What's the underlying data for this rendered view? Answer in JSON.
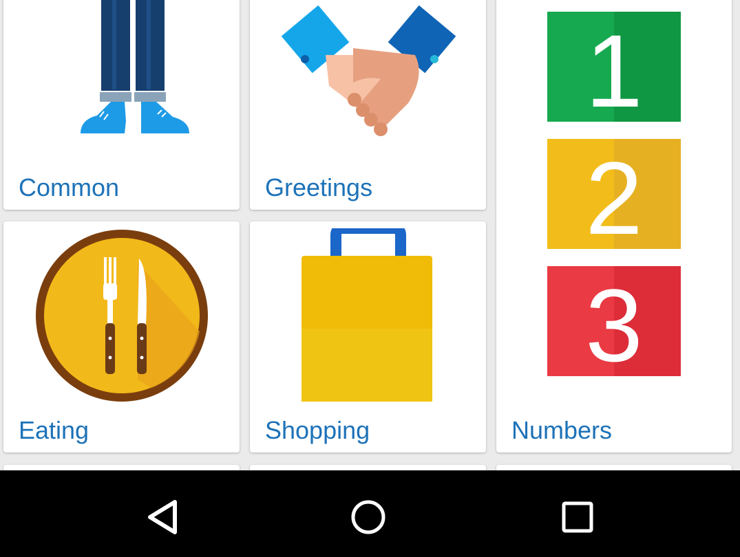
{
  "categories": [
    {
      "label": "Common",
      "icon": "person-legs-icon"
    },
    {
      "label": "Greetings",
      "icon": "handshake-icon"
    },
    {
      "label": "Numbers",
      "icon": "numbers-blocks-icon"
    },
    {
      "label": "Eating",
      "icon": "plate-fork-knife-icon"
    },
    {
      "label": "Shopping",
      "icon": "shopping-bag-icon"
    }
  ],
  "numbers_blocks": [
    "1",
    "2",
    "3"
  ],
  "colors": {
    "label_blue": "#1d72b8",
    "block_green": "#16a94f",
    "block_yellow": "#f2bd1a",
    "block_red": "#ea3a43",
    "background": "#ebebeb",
    "navbar": "#000000"
  },
  "navbar": {
    "back": "back-icon",
    "home": "home-icon",
    "recents": "recents-icon"
  }
}
